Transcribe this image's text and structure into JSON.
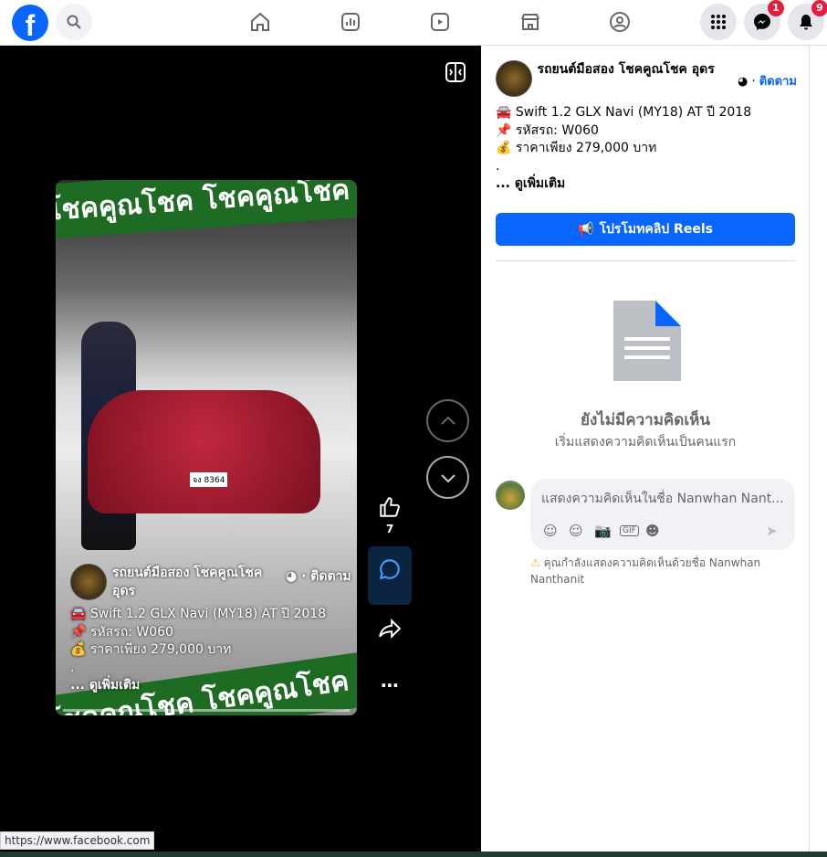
{
  "topbar": {
    "logo": "f",
    "notifications_badge": "9",
    "messenger_badge": "1"
  },
  "video": {
    "banner_top": "โชคคูณโชค โชคคูณโชค",
    "banner_bottom": "โชคคูณโชค โชคคูณโชค",
    "plate": "จง 8364",
    "page_name": "รถยนต์มือสอง โชคคูณโชค อุดร",
    "follow": "ติดตาม",
    "line1": "Swift 1.2 GLX Navi (MY18) AT ปี 2018",
    "line2": "รหัสรถ: W060",
    "line3": "ราคาเพียง 279,000 บาท",
    "dot": ".",
    "see_more": "... ดูเพิ่มเติม"
  },
  "actions": {
    "like_count": "7"
  },
  "post": {
    "page_name": "รถยนต์มือสอง โชคคูณโชค อุดร",
    "follow": "ติดตาม",
    "line1": "Swift 1.2 GLX Navi (MY18) AT ปี 2018",
    "line2": "รหัสรถ: W060",
    "line3": "ราคาเพียง 279,000 บาท",
    "dot": ".",
    "see_more": "... ดูเพิ่มเติม",
    "promote_label": "โปรโมทคลิป Reels"
  },
  "comments": {
    "empty_title": "ยังไม่มีความคิดเห็น",
    "empty_sub": "เริ่มแสดงความคิดเห็นเป็นคนแรก",
    "placeholder": "แสดงความคิดเห็นในชื่อ Nanwhan Nant...",
    "gif": "GIF",
    "warning": "คุณกำลังแสดงความคิดเห็นด้วยชื่อ Nanwhan Nanthanit"
  },
  "status_url": "https://www.facebook.com",
  "colors": {
    "accent": "#0866ff",
    "badge": "#e41e3f",
    "banner": "#1e6b24"
  }
}
